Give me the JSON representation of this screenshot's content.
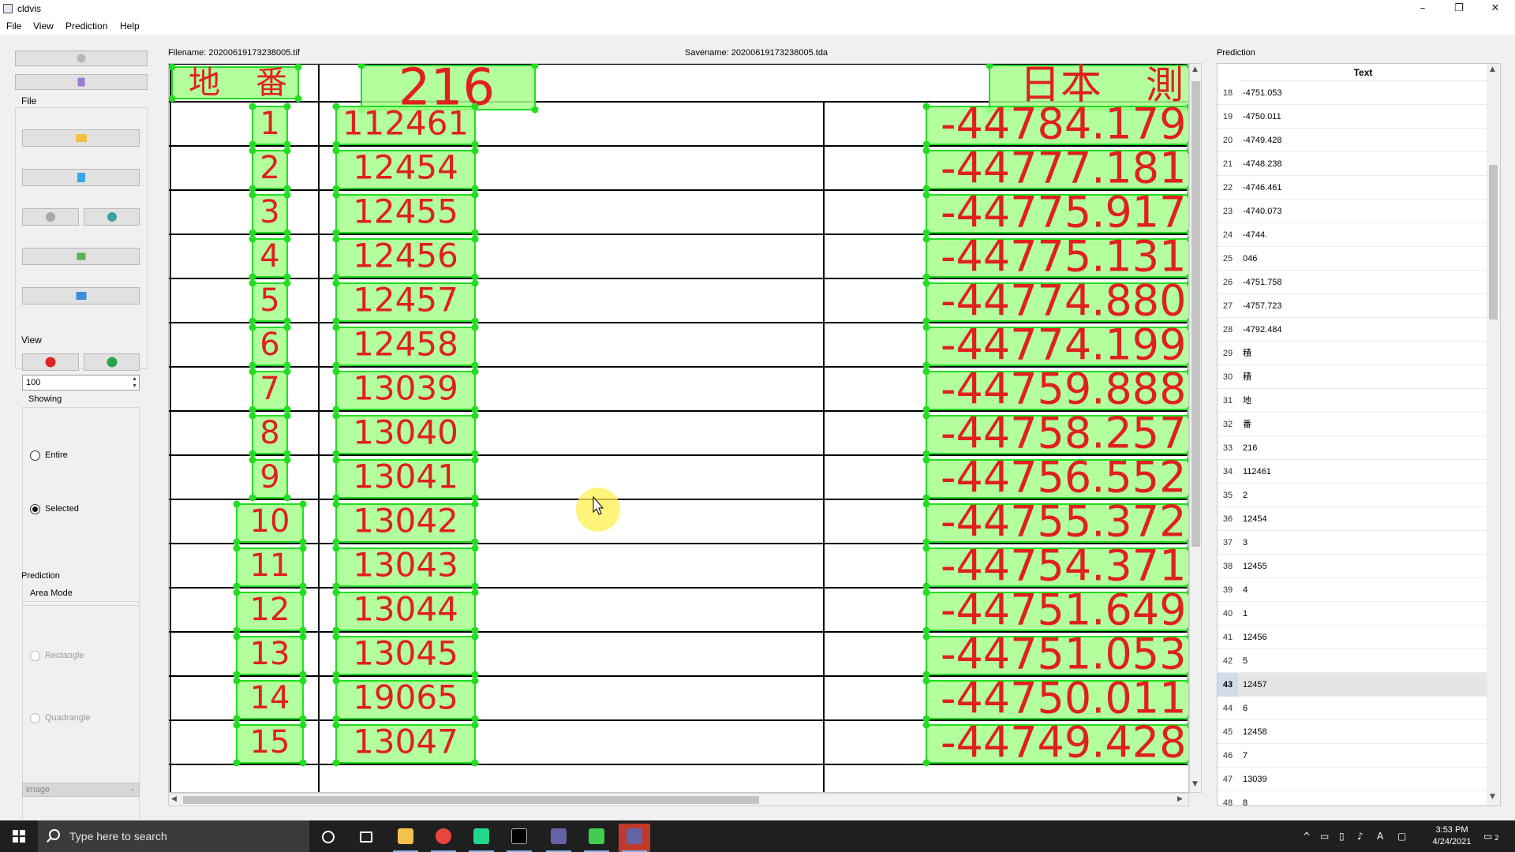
{
  "window": {
    "title": "cldvis",
    "minimize": "–",
    "maximize": "❐",
    "close": "✕"
  },
  "menu": [
    "File",
    "View",
    "Prediction",
    "Help"
  ],
  "left_panel": {
    "file_label": "File",
    "view_label": "View",
    "zoom_value": "100",
    "showing_label": "Showing",
    "showing_options": [
      "Entire",
      "Selected"
    ],
    "showing_selected": "Selected",
    "prediction_label": "Prediction",
    "area_mode_label": "Area Mode",
    "area_mode_options": [
      "Rectangle",
      "Quadrangle"
    ],
    "source_select": "image"
  },
  "header": {
    "filename": "Filename: 20200619173238005.tif",
    "savename": "Savename: 20200619173238005.tda"
  },
  "document": {
    "header": [
      "地",
      "番",
      "216",
      "日本",
      "測"
    ],
    "row_numbers": [
      "1",
      "2",
      "3",
      "4",
      "5",
      "6",
      "7",
      "8",
      "9",
      "10",
      "11",
      "12",
      "13",
      "14",
      "15"
    ],
    "codes": [
      "112461",
      "12454",
      "12455",
      "12456",
      "12457",
      "12458",
      "13039",
      "13040",
      "13041",
      "13042",
      "13043",
      "13044",
      "13045",
      "19065",
      "13047"
    ],
    "values": [
      "-44784.179",
      "-44777.181",
      "-44775.917",
      "-44775.131",
      "-44774.880",
      "-44774.199",
      "-44759.888",
      "-44758.257",
      "-44756.552",
      "-44755.372",
      "-44754.371",
      "-44751.649",
      "-44751.053",
      "-44750.011",
      "-44749.428"
    ]
  },
  "prediction": {
    "label": "Prediction",
    "column": "Text",
    "selected_index": "43",
    "rows": [
      {
        "i": "18",
        "t": "-4751.053"
      },
      {
        "i": "19",
        "t": "-4750.011"
      },
      {
        "i": "20",
        "t": "-4749.428"
      },
      {
        "i": "21",
        "t": "-4748.238"
      },
      {
        "i": "22",
        "t": "-4746.461"
      },
      {
        "i": "23",
        "t": "-4740.073"
      },
      {
        "i": "24",
        "t": "-4744."
      },
      {
        "i": "25",
        "t": "046"
      },
      {
        "i": "26",
        "t": "-4751.758"
      },
      {
        "i": "27",
        "t": "-4757.723"
      },
      {
        "i": "28",
        "t": "-4792.484"
      },
      {
        "i": "29",
        "t": "積"
      },
      {
        "i": "30",
        "t": "積"
      },
      {
        "i": "31",
        "t": "地"
      },
      {
        "i": "32",
        "t": "番"
      },
      {
        "i": "33",
        "t": "216"
      },
      {
        "i": "34",
        "t": "112461"
      },
      {
        "i": "35",
        "t": "2"
      },
      {
        "i": "36",
        "t": "12454"
      },
      {
        "i": "37",
        "t": "3"
      },
      {
        "i": "38",
        "t": "12455"
      },
      {
        "i": "39",
        "t": "4"
      },
      {
        "i": "40",
        "t": "1"
      },
      {
        "i": "41",
        "t": "12456"
      },
      {
        "i": "42",
        "t": "5"
      },
      {
        "i": "43",
        "t": "12457"
      },
      {
        "i": "44",
        "t": "6"
      },
      {
        "i": "45",
        "t": "12458"
      },
      {
        "i": "46",
        "t": "7"
      },
      {
        "i": "47",
        "t": "13039"
      },
      {
        "i": "48",
        "t": "8"
      }
    ]
  },
  "taskbar": {
    "search_placeholder": "Type here to search",
    "time": "3:53 PM",
    "date": "4/24/2021",
    "notifications": "2",
    "ime": "A"
  },
  "colors": {
    "box_fill": "#a6ff8c",
    "box_stroke": "#22dd22",
    "text_red": "#e02020",
    "selected_row": "#e5e5e5"
  }
}
